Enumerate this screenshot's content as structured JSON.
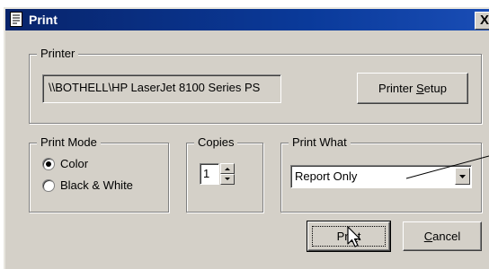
{
  "window": {
    "title": "Print",
    "close_label": "X"
  },
  "printer": {
    "group_label": "Printer",
    "current_printer": "\\\\BOTHELL\\HP LaserJet 8100 Series PS",
    "setup_button": {
      "before": "Printer ",
      "mnemonic": "S",
      "after": "etup"
    }
  },
  "print_mode": {
    "group_label": "Print Mode",
    "options": [
      {
        "label": "Color",
        "selected": true
      },
      {
        "label": "Black & White",
        "selected": false
      }
    ]
  },
  "copies": {
    "group_label": "Copies",
    "value": "1"
  },
  "print_what": {
    "group_label": "Print What",
    "selected": "Report Only"
  },
  "buttons": {
    "print": {
      "before": "Pri",
      "mnemonic": "n",
      "after": "t"
    },
    "cancel": {
      "before": "",
      "mnemonic": "C",
      "after": "ancel"
    }
  },
  "icons": {
    "window_icon": "document-icon",
    "close": "close-icon",
    "dropdown": "chevron-down-icon",
    "spin_up": "arrow-up-icon",
    "spin_down": "arrow-down-icon",
    "cursor": "mouse-pointer-icon"
  },
  "colors": {
    "titlebar": "#0a3a9a",
    "face": "#d4d0c8"
  }
}
